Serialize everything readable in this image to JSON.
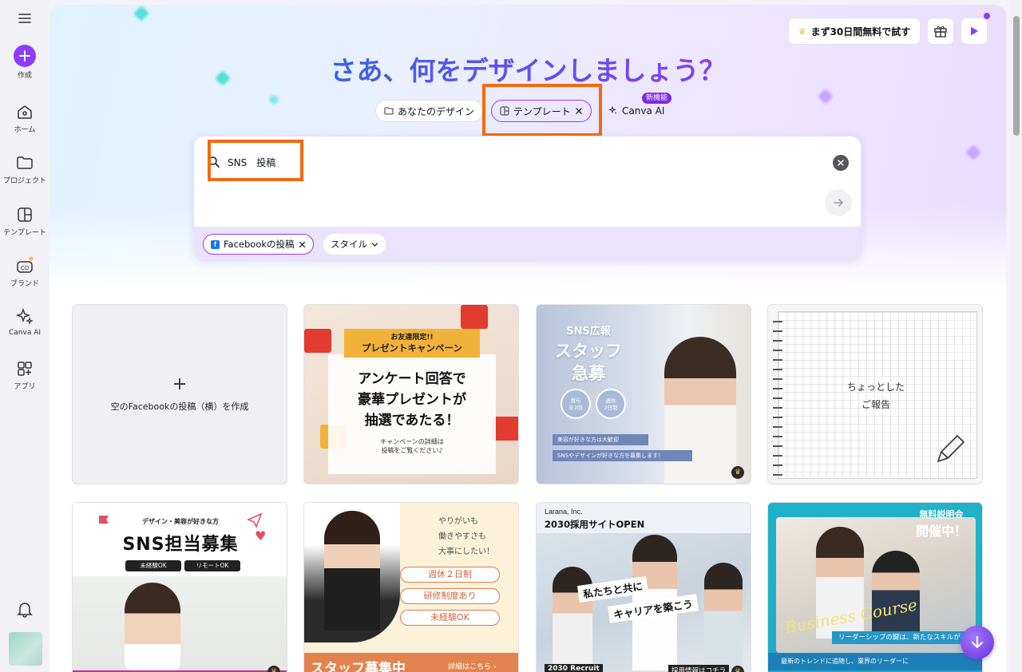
{
  "rail": {
    "create_label": "作成",
    "items": [
      {
        "label": "ホーム",
        "icon": "home-icon"
      },
      {
        "label": "プロジェクト",
        "icon": "folder-icon"
      },
      {
        "label": "テンプレート",
        "icon": "template-icon"
      },
      {
        "label": "ブランド",
        "icon": "brand-icon"
      },
      {
        "label": "Canva AI",
        "icon": "sparkle-icon"
      },
      {
        "label": "アプリ",
        "icon": "apps-icon"
      }
    ]
  },
  "header": {
    "trial_label": "まず30日間無料で試す",
    "headline": "さあ、何をデザインしましょう？"
  },
  "tabs": {
    "yours": "あなたのデザイン",
    "templates": "テンプレート",
    "canva_ai": "Canva AI",
    "new_badge": "新機能"
  },
  "search": {
    "query": "SNS　投稿",
    "chips": {
      "facebook": "Facebookの投稿",
      "style": "スタイル"
    }
  },
  "cards": {
    "blank_label": "空のFacebookの投稿（横）を作成",
    "t1": {
      "ribbon_small": "お友達限定!!",
      "ribbon_main": "プレゼントキャンペーン",
      "main_line1": "アンケート回答で",
      "main_line2": "豪華プレゼントが",
      "main_line3": "抽選であたる！",
      "sub_line1": "キャンペーンの詳細は",
      "sub_line2": "投稿をご覧ください♪"
    },
    "t2": {
      "small": "SNS広報",
      "big1": "スタッフ",
      "big2": "急募",
      "circle1": "賞与\n年2回",
      "circle2": "週休\n2日制",
      "pill1": "美容が好きな方は大歓迎",
      "pill2": "SNSやデザインが好きな方を募集します！"
    },
    "t3": {
      "line1": "ちょっとした",
      "line2": "ご報告"
    },
    "b1": {
      "small": "デザイン・美容が好きな方",
      "big": "SNS担当募集",
      "tag1": "未経験OK",
      "tag2": "リモートOK"
    },
    "b2": {
      "r1": "やりがいも",
      "r2": "働きやすさも",
      "r3": "大事にしたい！",
      "l1": "週休２日制",
      "l2": "研修制度あり",
      "l3": "未経験OK",
      "bottom": "スタッフ募集中",
      "bottom_sub": "詳細はこちら ›"
    },
    "b3": {
      "logo": "Larana, Inc.",
      "title": "2030採用サイトOPEN",
      "c1": "私たちと共に",
      "c2": "キャリアを築こう",
      "foot": "2030 Recruit",
      "foot2": "採用情報はコチラ"
    },
    "b4": {
      "badge1": "無料説明会",
      "badge2": "開催中！",
      "script": "Business Course",
      "strip": "リーダーシップの鍵は、新たなスキルが",
      "strip2": "最新のトレンドに追随し、業界のリーダーに"
    }
  }
}
